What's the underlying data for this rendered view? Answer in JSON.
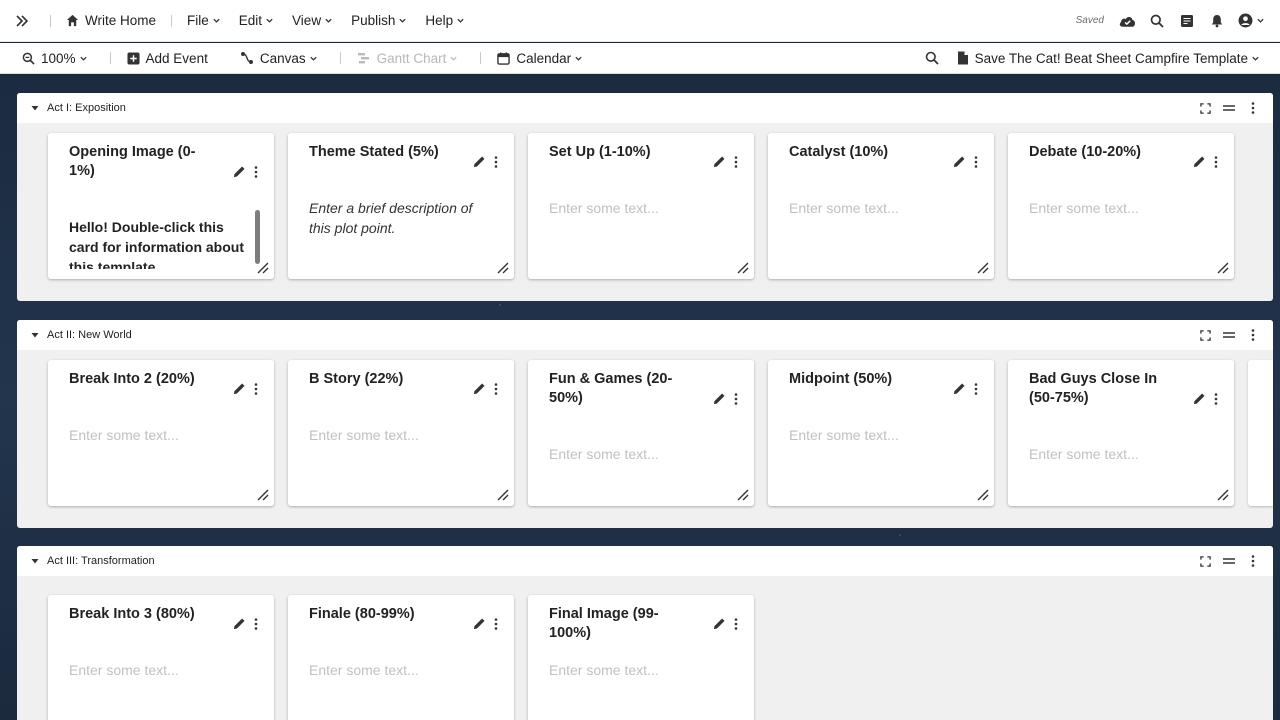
{
  "menubar": {
    "home_label": "Write Home",
    "menus": [
      "File",
      "Edit",
      "View",
      "Publish",
      "Help"
    ],
    "saved_label": "Saved"
  },
  "toolbar": {
    "zoom": "100%",
    "add_event": "Add Event",
    "canvas": "Canvas",
    "gantt": "Gantt Chart",
    "calendar": "Calendar",
    "template_name": "Save The Cat! Beat Sheet Campfire Template"
  },
  "placeholder": "Enter some text...",
  "acts": [
    {
      "title": "Act I: Exposition",
      "cards": [
        {
          "title": "Opening Image (0-1%)",
          "body": "Hello! Double-click this card for information about this template",
          "style": "bold"
        },
        {
          "title": "Theme Stated (5%)",
          "body": "Enter a brief description of this plot point.",
          "style": "italic"
        },
        {
          "title": "Set Up (1-10%)",
          "body": "",
          "style": "placeholder"
        },
        {
          "title": "Catalyst (10%)",
          "body": "",
          "style": "placeholder"
        },
        {
          "title": "Debate (10-20%)",
          "body": "",
          "style": "placeholder"
        }
      ]
    },
    {
      "title": "Act II: New World",
      "cards": [
        {
          "title": "Break Into 2 (20%)",
          "body": "",
          "style": "placeholder"
        },
        {
          "title": "B Story (22%)",
          "body": "",
          "style": "placeholder"
        },
        {
          "title": "Fun & Games (20-50%)",
          "body": "",
          "style": "placeholder"
        },
        {
          "title": "Midpoint (50%)",
          "body": "",
          "style": "placeholder"
        },
        {
          "title": "Bad Guys Close In (50-75%)",
          "body": "",
          "style": "placeholder"
        }
      ]
    },
    {
      "title": "Act III: Transformation",
      "cards": [
        {
          "title": "Break Into 3 (80%)",
          "body": "",
          "style": "placeholder"
        },
        {
          "title": "Finale (80-99%)",
          "body": "",
          "style": "placeholder"
        },
        {
          "title": "Final Image (99-100%)",
          "body": "",
          "style": "placeholder"
        }
      ]
    }
  ]
}
